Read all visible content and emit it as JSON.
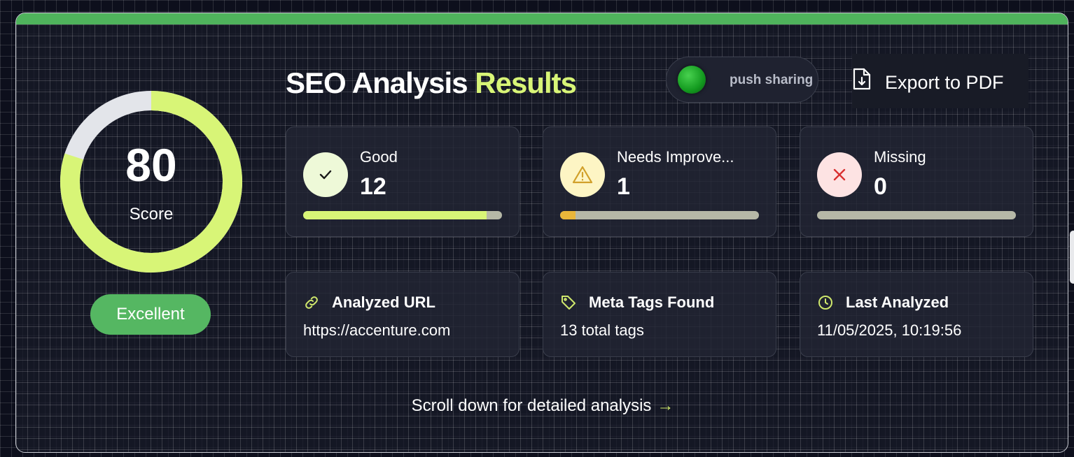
{
  "score": {
    "value": "80",
    "label": "Score",
    "fraction": 0.8,
    "rating": "Excellent"
  },
  "header": {
    "title_main": "SEO Analysis",
    "title_accent": "Results",
    "toggle_label": "push sharing",
    "export_label": "Export to PDF"
  },
  "stats": [
    {
      "label": "Good",
      "value": "12",
      "fill_fraction": 0.923,
      "color": "#d8f577"
    },
    {
      "label": "Needs Improve...",
      "value": "1",
      "fill_fraction": 0.077,
      "color": "#e9b63a"
    },
    {
      "label": "Missing",
      "value": "0",
      "fill_fraction": 0,
      "color": "#e34b4b"
    }
  ],
  "info": [
    {
      "title": "Analyzed URL",
      "value": "https://accenture.com",
      "icon": "link-icon"
    },
    {
      "title": "Meta Tags Found",
      "value": "13 total tags",
      "icon": "tag-icon"
    },
    {
      "title": "Last Analyzed",
      "value": "11/05/2025, 10:19:56",
      "icon": "clock-icon"
    }
  ],
  "footer": {
    "scroll_hint": "Scroll down for detailed analysis",
    "arrow": "→"
  },
  "colors": {
    "accent": "#d8f577",
    "success": "#4fb35c",
    "warning": "#e9b63a",
    "danger": "#e34b4b"
  }
}
